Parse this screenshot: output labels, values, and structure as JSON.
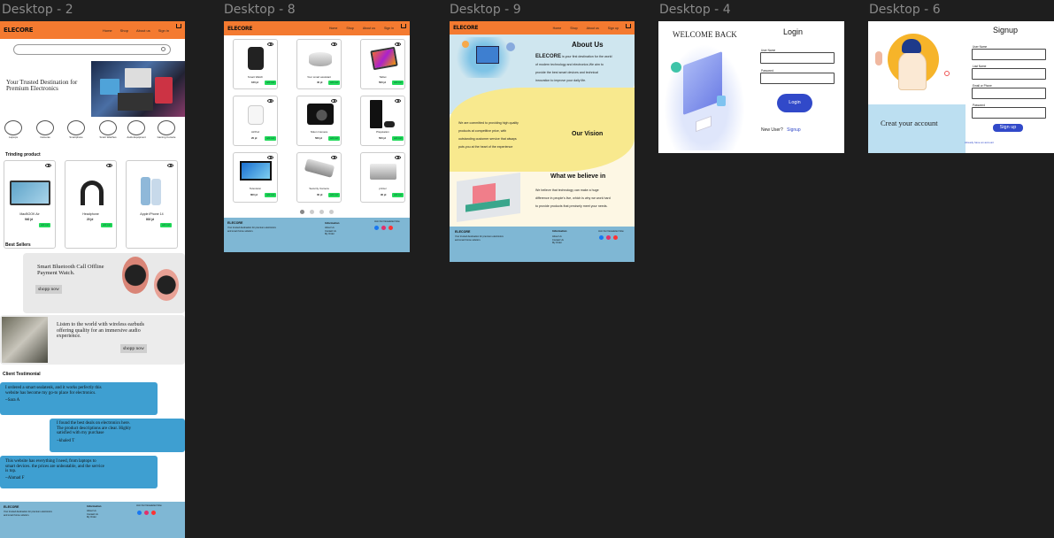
{
  "frames": {
    "d2": {
      "label": "Desktop - 2",
      "logo": "ELECORE",
      "nav": [
        "Home",
        "Shop",
        "About us",
        "Sign in"
      ],
      "hero_line1": "Your Trusted Destination for",
      "hero_line2": "Premium Electronics",
      "categories": [
        "Laptops",
        "Cameras",
        "Smartphone",
        "Smart Watches",
        "Audio Equipment",
        "Gaming Console"
      ],
      "trending_title": "Trinding product",
      "trending": [
        {
          "name": "MacBOOK Air",
          "price": "940 jd",
          "add": "add cart"
        },
        {
          "name": "Headphone",
          "price": "20 jd",
          "add": "add cart"
        },
        {
          "name": "Apple iPhone 14",
          "price": "802 jd",
          "add": "add cart"
        }
      ],
      "best_title": "Best  Sellers",
      "best1_line1": "Smart Bluetooth Call Offline",
      "best1_line2": "Payment Watch.",
      "shop_now": "shopp now",
      "best2_line1": "Listen to the world with wireless earbuds",
      "best2_line2": "offering quality for an immersive audio",
      "best2_line3": "experience.",
      "testimonial_title": "Client Testimonial",
      "t1_l1": "I ordered a smart sealatenk, and it works perfectly this",
      "t1_l2": "website has become my go-to place for electronics.",
      "t1_author": "~Sara A",
      "t2_l1": "I found the best deals on electronics here.",
      "t2_l2": "The product descriptions are clear. Highly",
      "t2_l3": "satisfied with my purchase",
      "t2_author": "~khaled  T",
      "t3_l1": "This website has everything I need, from laptops to",
      "t3_l2": "smart devices. the prices are unbeatable, and the service",
      "t3_l3": "is top.",
      "t3_author": "~Ahmad F"
    },
    "d8": {
      "label": "Desktop - 8",
      "logo": "ELECORE",
      "nav": [
        "Home",
        "Shop",
        "About us",
        "Sign in"
      ],
      "products": [
        {
          "name": "Smart Watch",
          "price": "160 jd",
          "add": "add cart"
        },
        {
          "name": "Your smart assistant",
          "price": "40 jd",
          "add": "add cart"
        },
        {
          "name": "Tablet",
          "price": "500 jd",
          "add": "add cart"
        },
        {
          "name": "AirPod",
          "price": "20 jd",
          "add": "add cart"
        },
        {
          "name": "Nikon Camera",
          "price": "560 jd",
          "add": "add cart"
        },
        {
          "name": "Playstation",
          "price": "500 jd",
          "add": "add cart"
        },
        {
          "name": "Television",
          "price": "800 jd",
          "add": "add cart"
        },
        {
          "name": "Security Camera",
          "price": "30 jd",
          "add": "add cart"
        },
        {
          "name": "printer",
          "price": "90 jd",
          "add": "add cart"
        }
      ]
    },
    "d9": {
      "label": "Desktop - 9",
      "logo": "ELECORE",
      "nav": [
        "Home",
        "Shop",
        "About us",
        "Sign up"
      ],
      "about_title": "About Us",
      "about_brand": "ELECORE",
      "about_l1": " is your first destination for the world",
      "about_l2": "of modern technology and electronics.We aim to",
      "about_l3": "provide the best smart devices and technical",
      "about_l4": "innovation to improve your daily life.",
      "vision_l1": "We are committed to providing high quality",
      "vision_l2": "products at competitive price, with",
      "vision_l3": "outstanding customer service that always",
      "vision_l4": "puts you at the heart of the experience",
      "vision_title": "Our Vision",
      "believe_title": "What we believe in",
      "believe_l1": "We believe that technology can make a huge",
      "believe_l2": "difference in people's live, which is why we work hard",
      "believe_l3": "to provide products that precisely meet your needs."
    },
    "d4": {
      "label": "Desktop - 4",
      "welcome": "WELCOME BACK",
      "title": "Login",
      "user_label": "User Name",
      "pass_label": "Password",
      "login_btn": "Login",
      "new_user": "New User?",
      "signup_link": "Signup"
    },
    "d6": {
      "label": "Desktop - 6",
      "create": "Creat your account",
      "title": "Signup",
      "f1": "User Name",
      "f2": "Last Name",
      "f3": "Email or Phone",
      "f4": "Password",
      "btn": "Sign up",
      "already": "Already have an account"
    }
  },
  "footer": {
    "brand": "ELECORE",
    "desc1": "Your trusted destination for premium electronics",
    "desc2": "and smart home solution.",
    "info_title": "Information",
    "links": [
      "About Us",
      "Contact Us",
      "My Order"
    ],
    "social_title": "Join Our Newsletter Now"
  },
  "colors": {
    "nav": "#f47a30",
    "footer": "#7fb7d4",
    "testimonial": "#3e9fd1",
    "add_cart": "#22d95a",
    "login_btn": "#3149c9"
  }
}
